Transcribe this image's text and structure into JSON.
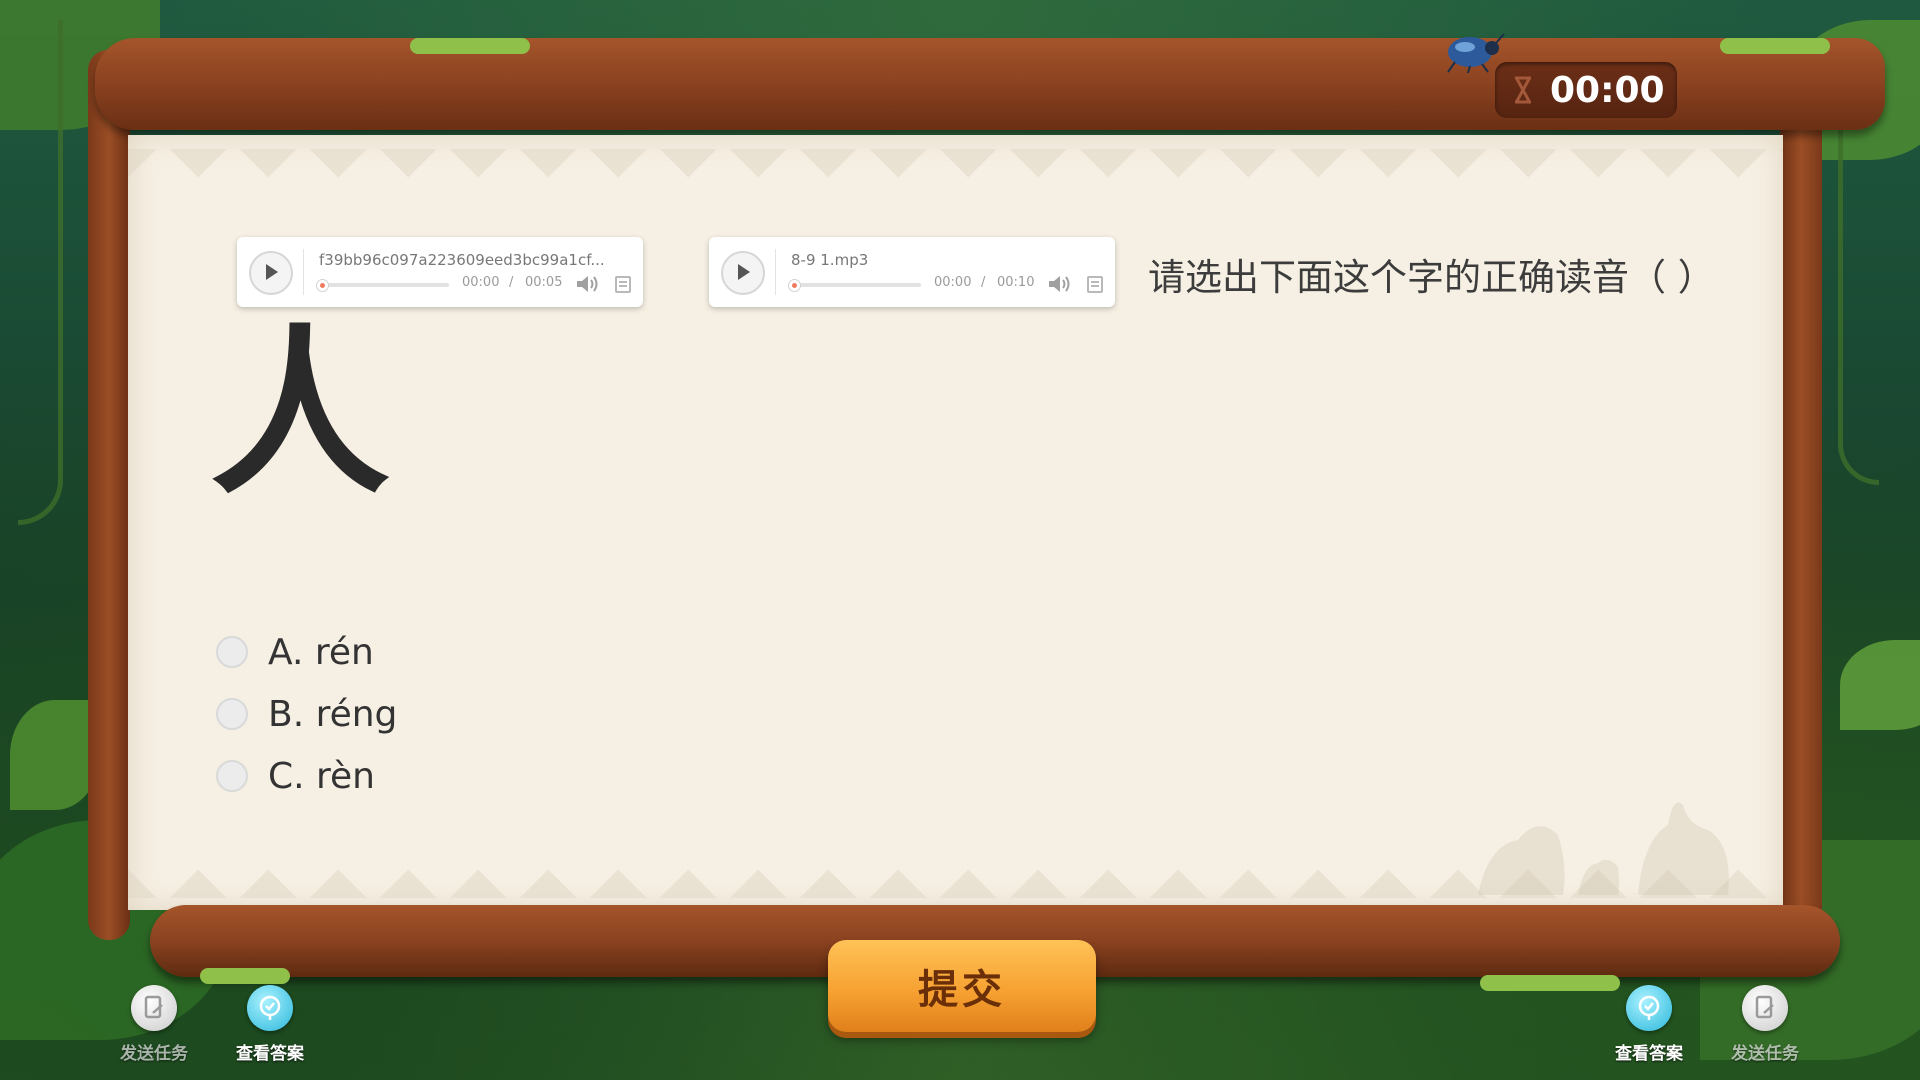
{
  "timer": {
    "value": "00:00"
  },
  "audio_players": [
    {
      "filename": "f39bb96c097a223609eed3bc99a1cf...",
      "current_time": "00:00",
      "separator": "/",
      "duration": "00:05"
    },
    {
      "filename": "8-9 1.mp3",
      "current_time": "00:00",
      "separator": "/",
      "duration": "00:10"
    }
  ],
  "question": {
    "text": "请选出下面这个字的正确读音（ ）",
    "character": "人"
  },
  "options": [
    {
      "label": "A. rén"
    },
    {
      "label": "B. réng"
    },
    {
      "label": "C. rèn"
    }
  ],
  "submit": {
    "label": "提交"
  },
  "tools": {
    "left": [
      {
        "label": "发送任务",
        "icon": "send-task-icon"
      },
      {
        "label": "查看答案",
        "icon": "view-answer-icon"
      }
    ],
    "right": [
      {
        "label": "查看答案",
        "icon": "view-answer-icon"
      },
      {
        "label": "发送任务",
        "icon": "send-task-icon"
      }
    ]
  },
  "colors": {
    "wood": "#8d4421",
    "parchment": "#f6f0e4",
    "submit": "#f7a232",
    "answer_blue": "#2cb7da"
  }
}
